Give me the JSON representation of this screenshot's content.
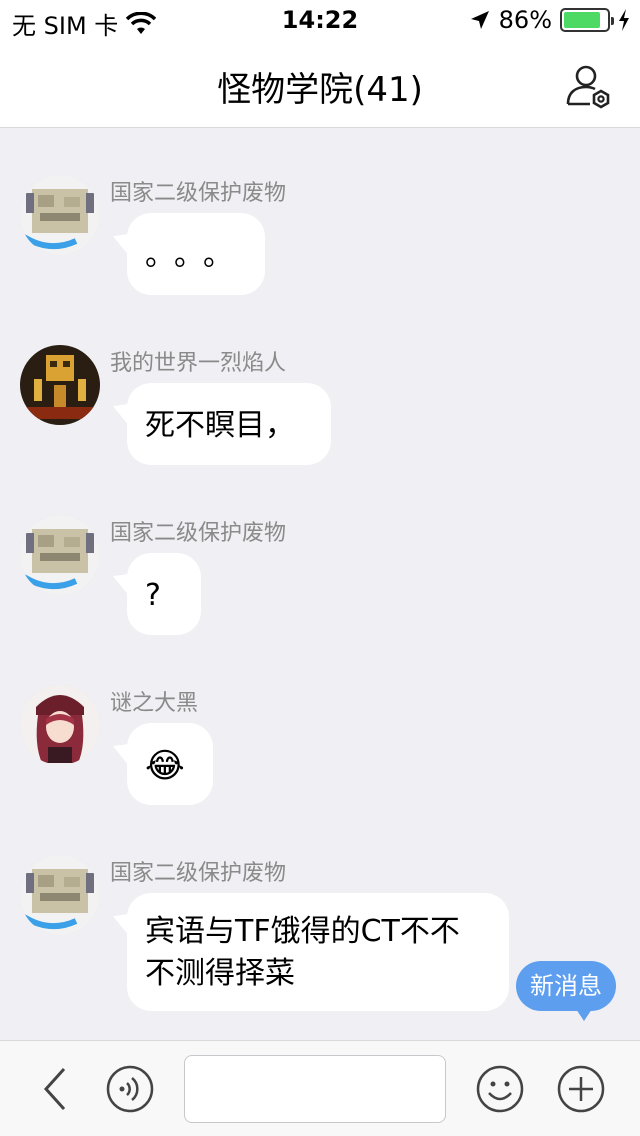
{
  "status_bar": {
    "carrier": "无 SIM 卡",
    "time": "14:22",
    "battery": "86%",
    "battery_level": 0.86,
    "battery_color": "#4cd964"
  },
  "navbar": {
    "title": "怪物学院(41)",
    "settings_icon": "group-settings-icon"
  },
  "messages": [
    {
      "sender": "国家二级保护废物",
      "text": "。。。",
      "avatar": "block-creature-avatar"
    },
    {
      "sender": "我的世界一烈焰人",
      "text": "死不瞑目，",
      "avatar": "blaze-avatar"
    },
    {
      "sender": "国家二级保护废物",
      "text": "?",
      "avatar": "block-creature-avatar"
    },
    {
      "sender": "谜之大黑",
      "text": "😂",
      "avatar": "anime-girl-avatar"
    },
    {
      "sender": "国家二级保护废物",
      "text_line1": "宾语与TF饿得的CT不不",
      "text_line2": "不测得择菜",
      "avatar": "block-creature-avatar"
    }
  ],
  "new_message_badge": "新消息",
  "bottom_bar": {
    "input_value": "",
    "icons": [
      "back-icon",
      "voice-icon",
      "emoji-icon",
      "plus-icon"
    ]
  },
  "colors": {
    "chat_background": "#efeff4",
    "accent": "#5d9eee"
  }
}
